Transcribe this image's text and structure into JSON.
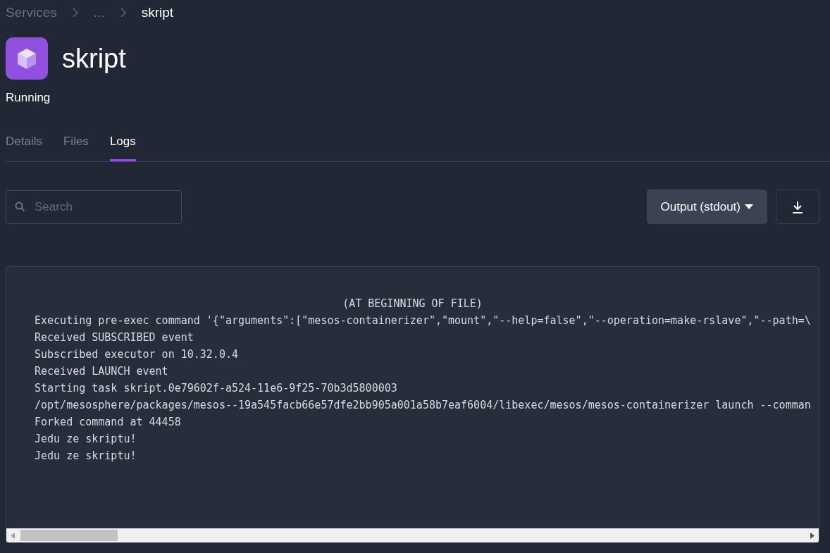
{
  "breadcrumbs": [
    "Services",
    "...",
    "skript"
  ],
  "service": {
    "name": "skript",
    "status": "Running"
  },
  "tabs": [
    {
      "label": "Details",
      "selected": false
    },
    {
      "label": "Files",
      "selected": false
    },
    {
      "label": "Logs",
      "selected": true
    }
  ],
  "search": {
    "placeholder": "Search"
  },
  "output_dropdown": {
    "label": "Output (stdout)"
  },
  "log": {
    "header": "(AT BEGINNING OF FILE)",
    "lines": [
      "Executing pre-exec command '{\"arguments\":[\"mesos-containerizer\",\"mount\",\"--help=false\",\"--operation=make-rslave\",\"--path=\\",
      "Received SUBSCRIBED event",
      "Subscribed executor on 10.32.0.4",
      "Received LAUNCH event",
      "Starting task skript.0e79602f-a524-11e6-9f25-70b3d5800003",
      "/opt/mesosphere/packages/mesos--19a545facb66e57dfe2bb905a001a58b7eaf6004/libexec/mesos/mesos-containerizer launch --comman",
      "Forked command at 44458",
      "Jedu ze skriptu!",
      "Jedu ze skriptu!"
    ]
  }
}
